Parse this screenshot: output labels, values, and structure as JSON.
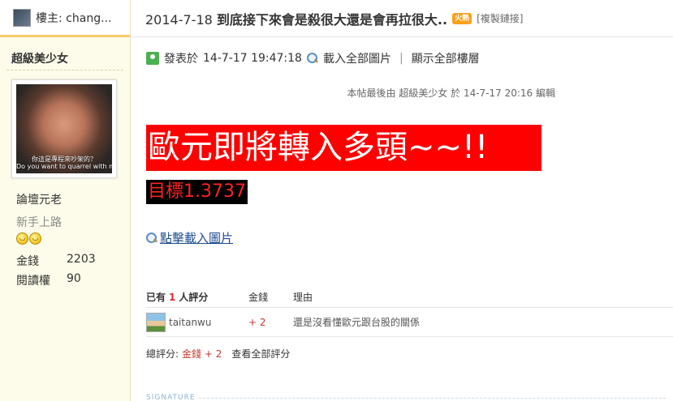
{
  "sidebar": {
    "owner_label": "樓主: chang...",
    "author_name": "超級美少女",
    "avatar_caption_line1": "你這是專程來吵架的？",
    "avatar_caption_line2": "Do you want to quarrel with m",
    "title_rank": "論壇元老",
    "rank_level": "新手上路",
    "stats": [
      {
        "label": "金錢",
        "value": "2203"
      },
      {
        "label": "閱讀權",
        "value": "90"
      }
    ]
  },
  "header": {
    "date_prefix": "2014-7-18",
    "title_bold": "到底接下來會是殺很大還是會再拉很大..",
    "hot_badge": "火熱",
    "copy_link": "[複製鏈接]"
  },
  "post_meta": {
    "posted_label": "發表於",
    "posted_time": "14-7-17 19:47:18",
    "load_all_images": "載入全部圖片",
    "separator": "|",
    "show_all_floors": "顯示全部樓層"
  },
  "edited_note": "本帖最後由 超級美少女 於 14-7-17 20:16 編輯",
  "content": {
    "headline": "歐元即將轉入多頭~~!!",
    "target": "目標1.3737",
    "load_image_link": "點擊載入圖片"
  },
  "rating": {
    "header_prefix": "已有",
    "count": "1",
    "header_suffix": "人評分",
    "col_money": "金錢",
    "col_reason": "理由",
    "rows": [
      {
        "user": "taitanwu",
        "money": "+ 2",
        "reason": "還是沒看懂歐元跟台股的關係"
      }
    ],
    "total_label": "總評分:",
    "total_value": "金錢 + 2",
    "view_all": "查看全部評分"
  },
  "signature_label": "SIGNATURE",
  "colors": {
    "headline_bg": "#ff0000",
    "target_bg": "#000000",
    "target_text": "#ff2222",
    "sidebar_bg": "#fdfcea"
  }
}
